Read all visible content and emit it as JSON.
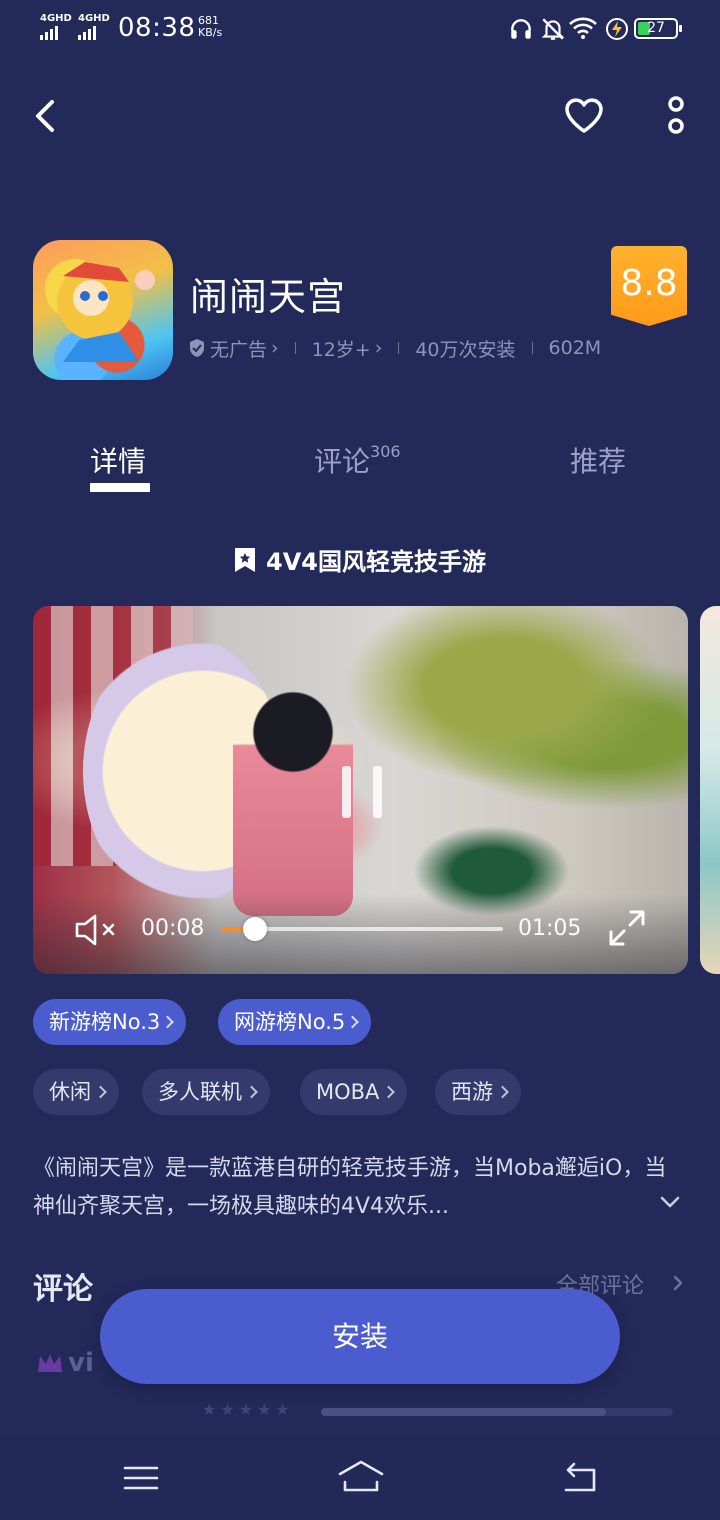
{
  "status_bar": {
    "network1": "4GHD",
    "network2": "4GHD",
    "time": "08:38",
    "speed_value": "681",
    "speed_unit": "KB/s",
    "battery": "27"
  },
  "app": {
    "name": "闹闹天宫",
    "rating": "8.8",
    "meta": {
      "ads": "无广告",
      "age": "12岁+",
      "installs": "40万次安装",
      "size": "602M"
    }
  },
  "tabs": [
    {
      "label": "详情",
      "count": ""
    },
    {
      "label": "评论",
      "count": "306"
    },
    {
      "label": "推荐",
      "count": ""
    }
  ],
  "subtitle": "4V4国风轻竞技手游",
  "video": {
    "current_time": "00:08",
    "total_time": "01:05",
    "progress": 0.12
  },
  "rank_chips": [
    "新游榜No.3",
    "网游榜No.5"
  ],
  "tag_chips": [
    "休闲",
    "多人联机",
    "MOBA",
    "西游"
  ],
  "description": "《闹闹天宫》是一款蓝港自研的轻竞技手游，当Moba邂逅iO，当神仙齐聚天宫，一场极具趣味的4V4欢乐...",
  "reviews": {
    "title": "评论",
    "all_link": "全部评论",
    "brand": "vi"
  },
  "install_button": "安装",
  "colors": {
    "background": "#232a5a",
    "accent": "#4b5ccf",
    "rating_badge": "#ffa521",
    "tag_chip": "#343a6c"
  },
  "icons": {
    "back": "chevron-left-icon",
    "favorite": "heart-icon",
    "more": "more-vertical-icon",
    "verified": "shield-check-icon",
    "subtitle": "bookmark-star-icon",
    "mute": "volume-mute-icon",
    "fullscreen": "fullscreen-icon",
    "expand": "chevron-down-icon",
    "nav_menu": "menu-icon",
    "nav_home": "home-icon",
    "nav_back": "return-icon"
  }
}
